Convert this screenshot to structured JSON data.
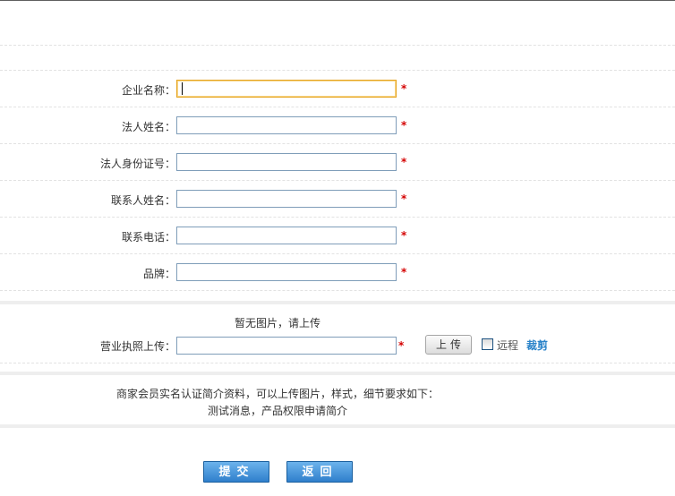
{
  "form": {
    "fields": [
      {
        "label": "企业名称：",
        "value": "",
        "required_mark": "*"
      },
      {
        "label": "法人姓名：",
        "value": "",
        "required_mark": "*"
      },
      {
        "label": "法人身份证号：",
        "value": "",
        "required_mark": "*"
      },
      {
        "label": "联系人姓名：",
        "value": "",
        "required_mark": "*"
      },
      {
        "label": "联系电话：",
        "value": "",
        "required_mark": "*"
      },
      {
        "label": "品牌：",
        "value": "",
        "required_mark": "*"
      }
    ]
  },
  "license": {
    "no_image_text": "暂无图片，请上传",
    "label": "营业执照上传：",
    "value": "",
    "required_mark": "*",
    "upload_button": "上传",
    "remote_label": "远程",
    "crop_link": "裁剪"
  },
  "note": {
    "line1": "商家会员实名认证简介资料，可以上传图片，样式，细节要求如下：",
    "line2": "测试消息，产品权限申请简介"
  },
  "buttons": {
    "submit": "提交",
    "back": "返回"
  },
  "colors": {
    "required": "#d40000",
    "button_blue": "#2f7fcc",
    "link_blue": "#2a83c9",
    "focus_border": "#e6a41f"
  }
}
